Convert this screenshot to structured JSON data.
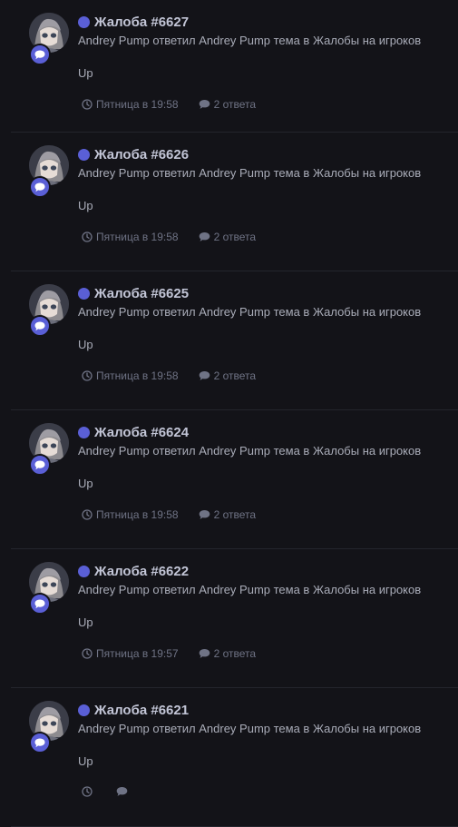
{
  "feed": {
    "items": [
      {
        "title": "Жалоба #6627",
        "description": "Andrey Pump ответил Andrey Pump тема в Жалобы на игроков",
        "snippet": "Up",
        "time": "Пятница в 19:58",
        "replies": "2 ответа"
      },
      {
        "title": "Жалоба #6626",
        "description": "Andrey Pump ответил Andrey Pump тема в Жалобы на игроков",
        "snippet": "Up",
        "time": "Пятница в 19:58",
        "replies": "2 ответа"
      },
      {
        "title": "Жалоба #6625",
        "description": "Andrey Pump ответил Andrey Pump тема в Жалобы на игроков",
        "snippet": "Up",
        "time": "Пятница в 19:58",
        "replies": "2 ответа"
      },
      {
        "title": "Жалоба #6624",
        "description": "Andrey Pump ответил Andrey Pump тема в Жалобы на игроков",
        "snippet": "Up",
        "time": "Пятница в 19:58",
        "replies": "2 ответа"
      },
      {
        "title": "Жалоба #6622",
        "description": "Andrey Pump ответил Andrey Pump тема в Жалобы на игроков",
        "snippet": "Up",
        "time": "Пятница в 19:57",
        "replies": "2 ответа"
      },
      {
        "title": "Жалоба #6621",
        "description": "Andrey Pump ответил Andrey Pump тема в Жалобы на игроков",
        "snippet": "Up",
        "time": "",
        "replies": ""
      }
    ]
  },
  "colors": {
    "background": "#131318",
    "accent": "#5a5fd6",
    "meta_text": "#6f7385"
  },
  "icons": {
    "badge": "chat-bubble-icon",
    "time": "clock-icon",
    "replies": "comment-icon"
  }
}
